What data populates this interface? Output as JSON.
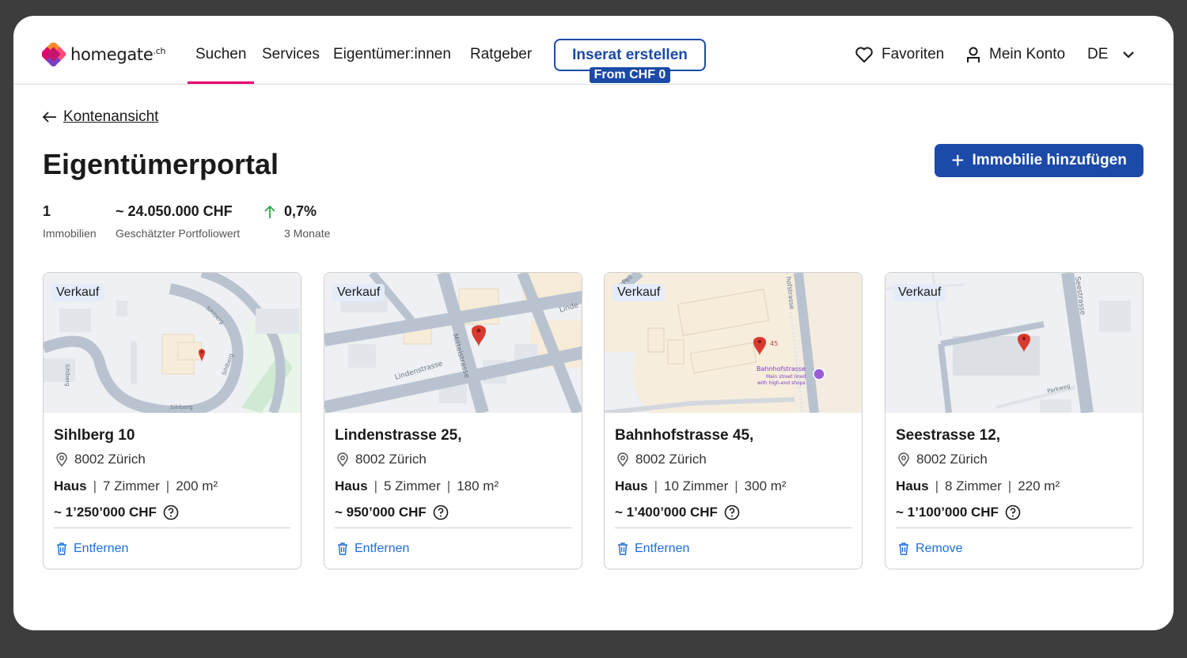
{
  "brand": {
    "name": "homegate",
    "suffix": ".ch"
  },
  "nav": {
    "items": [
      {
        "label": "Suchen",
        "active": true
      },
      {
        "label": "Services"
      },
      {
        "label": "Eigentümer:innen"
      },
      {
        "label": "Ratgeber"
      }
    ],
    "cta_label": "Inserat erstellen",
    "cta_badge": "From CHF 0",
    "favorites_label": "Favoriten",
    "account_label": "Mein Konto",
    "language": "DE"
  },
  "back_link": "Kontenansicht",
  "page_title": "Eigentümerportal",
  "add_button": "Immobilie hinzufügen",
  "stats": [
    {
      "value": "1",
      "label": "Immobilien"
    },
    {
      "value": "~ 24.050.000 CHF",
      "label": "Geschätzter Portfoliowert"
    },
    {
      "value": "0,7%",
      "label": "3 Monate",
      "trend": "up"
    }
  ],
  "properties": [
    {
      "tag": "Verkauf",
      "title": "Sihlberg 10",
      "location": "8002 Zürich",
      "type": "Haus",
      "rooms": "7 Zimmer",
      "area": "200 m²",
      "price": "~ 1’250’000 CHF",
      "remove": "Entfernen"
    },
    {
      "tag": "Verkauf",
      "title": "Lindenstrasse 25,",
      "location": "8002 Zürich",
      "type": "Haus",
      "rooms": "5 Zimmer",
      "area": "180 m²",
      "price": "~ 950’000 CHF",
      "remove": "Entfernen"
    },
    {
      "tag": "Verkauf",
      "title": "Bahnhofstrasse 45,",
      "location": "8002 Zürich",
      "type": "Haus",
      "rooms": "10 Zimmer",
      "area": "300 m²",
      "price": "~ 1’400’000 CHF",
      "remove": "Entfernen"
    },
    {
      "tag": "Verkauf",
      "title": "Seestrasse 12,",
      "location": "8002 Zürich",
      "type": "Haus",
      "rooms": "8 Zimmer",
      "area": "220 m²",
      "price": "~ 1’100’000 CHF",
      "remove": "Remove"
    }
  ],
  "map_labels": {
    "card1": [
      "Sihlberg",
      "Sihlberg",
      "Sihlberg",
      "Sihlberg"
    ],
    "card2": [
      "Lindenstrasse",
      "Mittelstrasse",
      "Linde"
    ],
    "card3": [
      "45",
      "Bahnhofstrasse",
      "Main street lined",
      "with high-end shops",
      "Peli",
      "hofstrasse"
    ],
    "card4": [
      "Seestrasse",
      "Parkweg"
    ]
  },
  "colors": {
    "accent": "#1b4aa8",
    "brand_pink": "#e5006e",
    "link": "#1b6fd6",
    "pin": "#d93a2f",
    "trend_up": "#2ea84a"
  }
}
